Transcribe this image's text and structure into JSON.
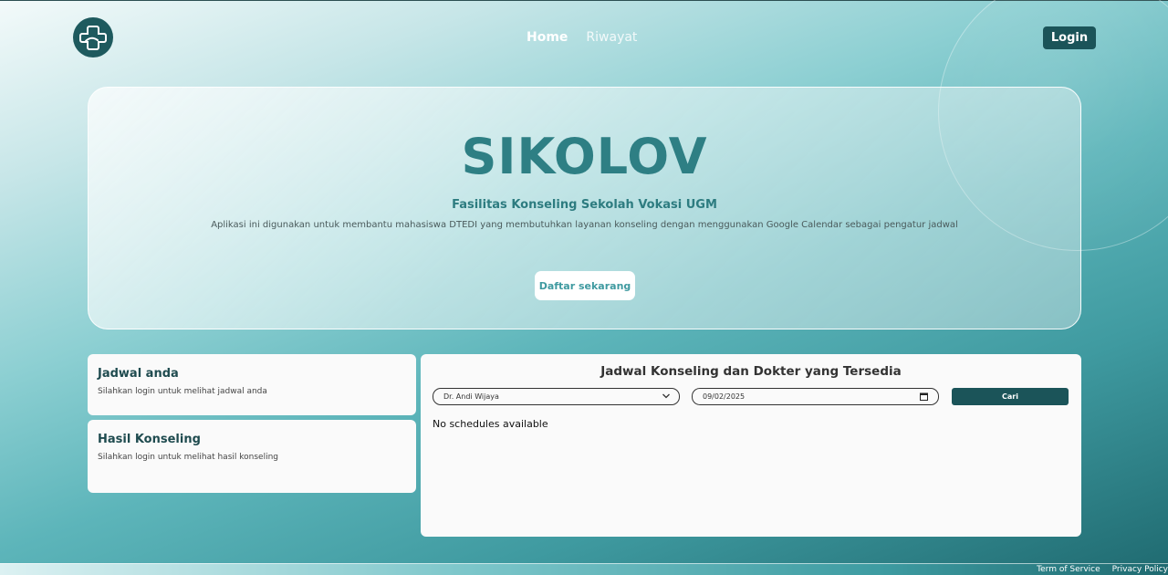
{
  "header": {
    "logo_icon": "medical-cross-logo-icon",
    "nav": [
      {
        "label": "Home",
        "active": true
      },
      {
        "label": "Riwayat",
        "active": false
      }
    ],
    "login_label": "Login"
  },
  "hero": {
    "title": "SIKOLOV",
    "subtitle": "Fasilitas Konseling Sekolah Vokasi UGM",
    "description": "Aplikasi ini digunakan untuk membantu mahasiswa DTEDI yang membutuhkan layanan konseling dengan menggunakan Google Calendar sebagai pengatur jadwal",
    "cta_label": "Daftar sekarang"
  },
  "jadwal_card": {
    "title": "Jadwal anda",
    "text": "Silahkan login untuk melihat jadwal anda"
  },
  "hasil_card": {
    "title": "Hasil Konseling",
    "text": "Silahkan login untuk melihat hasil konseling"
  },
  "schedule_panel": {
    "title": "Jadwal Konseling dan Dokter yang Tersedia",
    "doctor_selected": "Dr. Andi Wijaya",
    "date_value": "09/02/2025",
    "search_label": "Cari",
    "empty_message": "No schedules available"
  },
  "footer": {
    "links": [
      "Term of Service",
      "Privacy Policy"
    ]
  },
  "colors": {
    "primary_dark": "#1b5459",
    "accent_teal": "#2e7f84",
    "button_text_teal": "#3f9aa0"
  }
}
